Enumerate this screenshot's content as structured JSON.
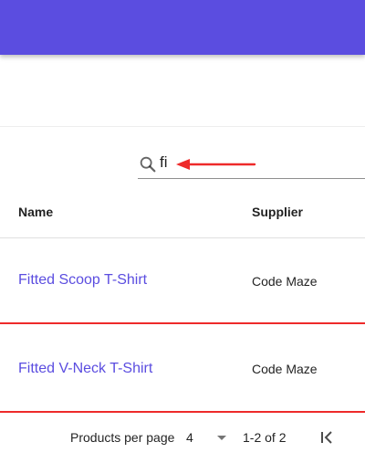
{
  "colors": {
    "app_bar": "#5b4de0",
    "link": "#5b4de0",
    "annotation_red": "#ee2a2a"
  },
  "search": {
    "value": "fi",
    "icon": "search-icon"
  },
  "table": {
    "columns": [
      "Name",
      "Supplier"
    ],
    "rows": [
      {
        "name": "Fitted Scoop T-Shirt",
        "supplier": "Code Maze"
      },
      {
        "name": "Fitted V-Neck T-Shirt",
        "supplier": "Code Maze"
      }
    ]
  },
  "pagination": {
    "label": "Products per page",
    "page_size": "4",
    "range": "1-2 of 2",
    "first_page_icon": "first-page-icon"
  }
}
